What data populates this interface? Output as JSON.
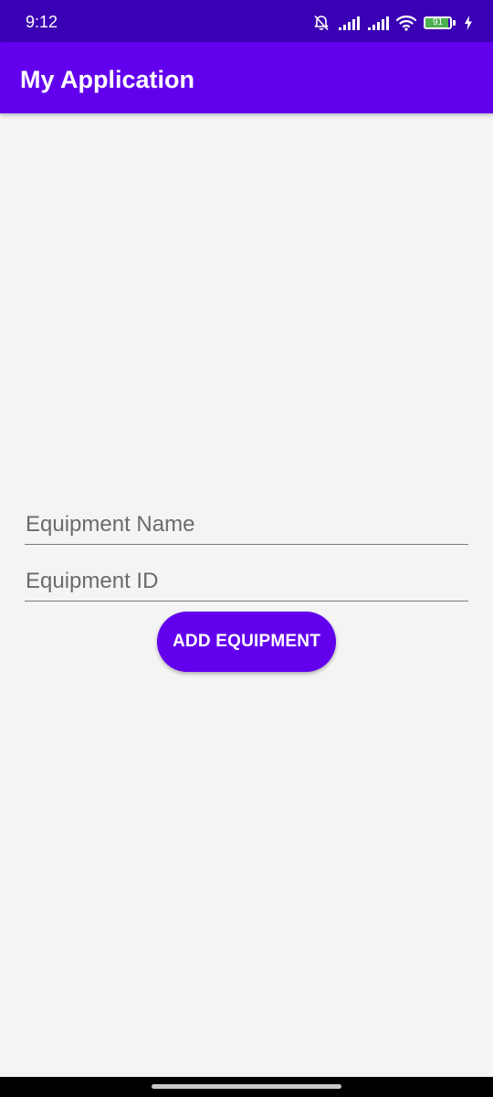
{
  "status_bar": {
    "time": "9:12",
    "battery_level": "91",
    "battery_fraction": 0.91,
    "icons": [
      "bell-off-icon",
      "signal-icon",
      "signal-icon",
      "wifi-icon",
      "battery-icon",
      "charging-icon"
    ],
    "background_color": "#3a00b3"
  },
  "app_bar": {
    "title": "My Application",
    "background_color": "#6200ee"
  },
  "form": {
    "equipment_name": {
      "value": "",
      "placeholder": "Equipment Name"
    },
    "equipment_id": {
      "value": "",
      "placeholder": "Equipment ID"
    },
    "add_button_label": "ADD EQUIPMENT",
    "button_color": "#6200ee"
  },
  "nav_bar": {
    "background_color": "#000000"
  }
}
